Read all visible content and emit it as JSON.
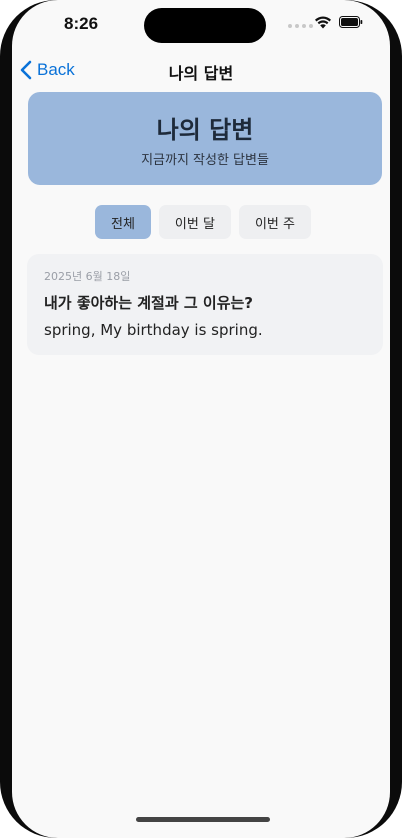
{
  "status_bar": {
    "time": "8:26",
    "icons": [
      "cellular-signal-icon",
      "wifi-icon",
      "battery-icon"
    ]
  },
  "nav": {
    "back_label": "Back",
    "title": "나의 답변",
    "back_icon": "chevron-left-icon",
    "accent_color": "#0a72d8"
  },
  "header": {
    "title": "나의 답변",
    "subtitle": "지금까지 작성한 답변들",
    "background_color": "#9ab7dc"
  },
  "filters": {
    "selected": "전체",
    "tabs": [
      {
        "label": "전체"
      },
      {
        "label": "이번 달"
      },
      {
        "label": "이번 주"
      }
    ]
  },
  "answers": [
    {
      "date": "2025년 6월 18일",
      "question": "내가 좋아하는 계절과 그 이유는?",
      "answer": "spring, My birthday is spring."
    }
  ]
}
